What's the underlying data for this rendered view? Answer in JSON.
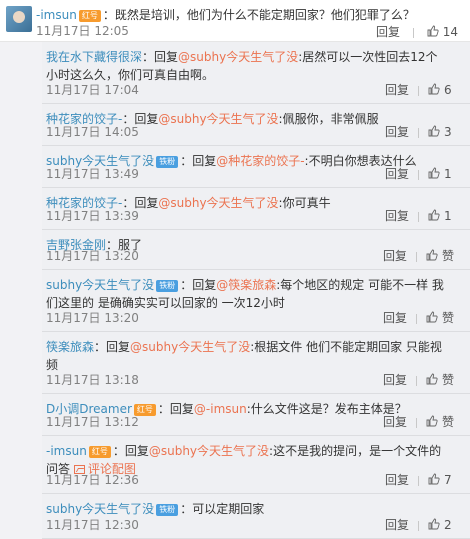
{
  "top": {
    "user": "-imsun",
    "badge": "红号",
    "content": "：既然是培训，他们为什么不能定期回家？他们犯罪了么？",
    "time": "11月17日 12:05",
    "reply_label": "回复",
    "likes": "14"
  },
  "replies": [
    {
      "user": "我在水下藏得很深",
      "pre": "：回复",
      "mention": "@subhy今天生气了没",
      "post": ":居然可以一次性回去12个小时这么久，你们可真自由啊。",
      "time": "11月17日 17:04",
      "reply_label": "回复",
      "likes": "6"
    },
    {
      "user": "种花家的饺子-",
      "pre": "：回复",
      "mention": "@subhy今天生气了没",
      "post": ":佩服你，非常佩服",
      "time": "11月17日 14:05",
      "reply_label": "回复",
      "likes": "3"
    },
    {
      "user": "subhy今天生气了没",
      "badge": "铁粉",
      "pre": "：回复",
      "mention": "@种花家的饺子-",
      "post": ":不明白你想表达什么",
      "time": "11月17日 13:49",
      "reply_label": "回复",
      "likes": "1"
    },
    {
      "user": "种花家的饺子-",
      "pre": "：回复",
      "mention": "@subhy今天生气了没",
      "post": ":你可真牛",
      "time": "11月17日 13:39",
      "reply_label": "回复",
      "likes": "1"
    },
    {
      "user": "吉野张金刚",
      "pre": "：服了",
      "mention": "",
      "post": "",
      "time": "11月17日 13:20",
      "reply_label": "回复",
      "likes": "赞"
    },
    {
      "user": "subhy今天生气了没",
      "badge": "铁粉",
      "pre": "：回复",
      "mention": "@筷楽旅森",
      "post": ":每个地区的规定 可能不一样 我们这里的 是确确实实可以回家的 一次12小时",
      "time": "11月17日 13:20",
      "reply_label": "回复",
      "likes": "赞"
    },
    {
      "user": "筷楽旅森",
      "pre": "：回复",
      "mention": "@subhy今天生气了没",
      "post": ":根据文件 他们不能定期回家 只能视频",
      "time": "11月17日 13:18",
      "reply_label": "回复",
      "likes": "赞"
    },
    {
      "user": "D小调Dreamer",
      "badge": "红号",
      "pre": "：回复",
      "mention": "@-imsun",
      "post": ":什么文件这是？发布主体是？",
      "time": "11月17日 13:12",
      "reply_label": "回复",
      "likes": "赞"
    },
    {
      "user": "-imsun",
      "badge": "红号",
      "pre": "：回复",
      "mention": "@subhy今天生气了没",
      "post": ":这不是我的提问，是一个文件的问答",
      "image_link": "评论配图",
      "time": "11月17日 12:36",
      "reply_label": "回复",
      "likes": "7"
    },
    {
      "user": "subhy今天生气了没",
      "badge": "铁粉",
      "pre": "：可以定期回家",
      "mention": "",
      "post": "",
      "time": "11月17日 12:30",
      "reply_label": "回复",
      "likes": "2"
    }
  ],
  "icons": {
    "like": "thumbs-up-icon",
    "image": "image-icon"
  },
  "colors": {
    "username": "#eb7350",
    "blue_username": "#3c8dbc",
    "background": "#eff0f3",
    "vip_badge": "#f79b2e",
    "fan_badge": "#4a9fe0"
  }
}
